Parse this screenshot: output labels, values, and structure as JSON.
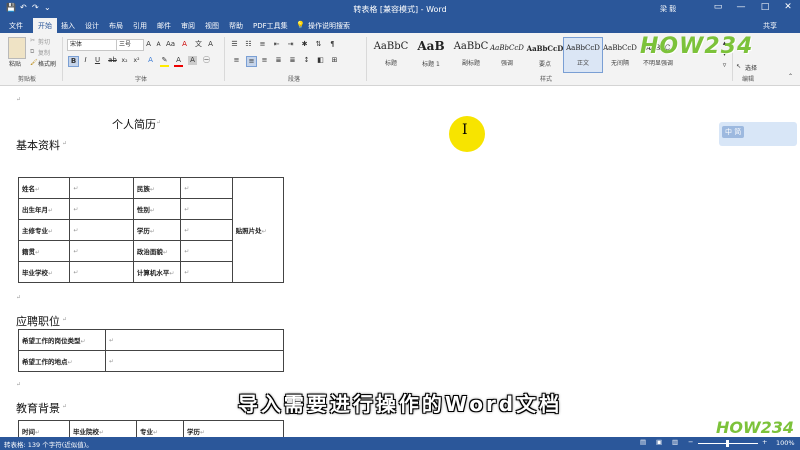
{
  "window": {
    "title": "转表格 [兼容模式] - Word",
    "user": "梁 毅",
    "share": "共享",
    "quick_access": [
      "💾",
      "↶",
      "↷",
      "⌄"
    ],
    "controls": [
      "▭",
      "—",
      "□",
      "✕"
    ]
  },
  "tabs": [
    {
      "label": "文件"
    },
    {
      "label": "开始"
    },
    {
      "label": "插入"
    },
    {
      "label": "设计"
    },
    {
      "label": "布局"
    },
    {
      "label": "引用"
    },
    {
      "label": "邮件"
    },
    {
      "label": "审阅"
    },
    {
      "label": "视图"
    },
    {
      "label": "帮助"
    },
    {
      "label": "PDF工具集"
    }
  ],
  "tell_me": "操作说明搜索",
  "ribbon": {
    "clipboard": {
      "paste": "粘贴",
      "cut": "剪切",
      "copy": "复制",
      "format_painter": "格式刷",
      "label": "剪贴板"
    },
    "font": {
      "name": "宋体",
      "size": "三号",
      "label": "字体",
      "bold": "B",
      "italic": "I",
      "underline": "U"
    },
    "paragraph": {
      "label": "段落"
    },
    "styles": {
      "label": "样式",
      "items": [
        {
          "preview": "AaBbC",
          "name": "标题"
        },
        {
          "preview": "AaB",
          "name": "标题 1"
        },
        {
          "preview": "AaBbC",
          "name": "副标题"
        },
        {
          "preview": "AaBbCcD",
          "name": "强调"
        },
        {
          "preview": "AaBbCcD",
          "name": "要点"
        },
        {
          "preview": "AaBbCcD",
          "name": "正文"
        },
        {
          "preview": "AaBbCcD",
          "name": "无间隔"
        },
        {
          "preview": "AaBbC",
          "name": "不明显强调"
        }
      ]
    },
    "editing": {
      "select": "选择",
      "label": "编辑"
    }
  },
  "document": {
    "title": "个人简历",
    "section_basic": "基本资料",
    "section_job": "应聘职位",
    "section_edu": "教育背景",
    "basic_table": [
      [
        "姓名",
        "",
        "民族",
        ""
      ],
      [
        "出生年月",
        "",
        "性别",
        ""
      ],
      [
        "主修专业",
        "",
        "学历",
        ""
      ],
      [
        "籍贯",
        "",
        "政治面貌",
        ""
      ],
      [
        "毕业学校",
        "",
        "计算机水平",
        ""
      ]
    ],
    "photo_cell": "贴照片处",
    "job_table": [
      [
        "希望工作的岗位类型",
        ""
      ],
      [
        "希望工作的地点",
        ""
      ]
    ],
    "edu_headers": [
      "时间",
      "毕业院校",
      "专业",
      "学历"
    ],
    "para_mark": "↵"
  },
  "caption": "导入需要进行操作的Word文档",
  "watermark": {
    "top_text": "HOW234",
    "bottom_text": "HOW234",
    "badge": "中 简"
  },
  "status": {
    "words": "转表格: 139 个字符(近似值)。",
    "zoom": "100%"
  },
  "colors": {
    "word_blue": "#2b579a",
    "cursor_yellow": "#f7e400",
    "logo_green": "#7cc23a"
  }
}
